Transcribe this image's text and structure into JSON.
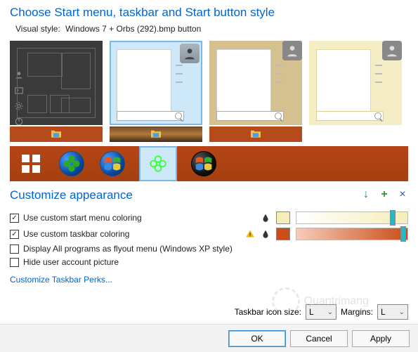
{
  "heading": "Choose Start menu, taskbar and Start button style",
  "visual_style_label": "Visual style:",
  "visual_style_value": "Windows 7 + Orbs (292).bmp button",
  "themes": [
    {
      "id": "modern-dark",
      "selected": false
    },
    {
      "id": "win7-gradient",
      "selected": true
    },
    {
      "id": "win7-tan",
      "selected": false
    },
    {
      "id": "win7-cream",
      "selected": false
    }
  ],
  "orbs": [
    {
      "id": "win8-tiles",
      "selected": false
    },
    {
      "id": "green-clover-sphere",
      "selected": false
    },
    {
      "id": "win7-orb",
      "selected": false
    },
    {
      "id": "glowing-clover",
      "selected": true
    },
    {
      "id": "dark-orb",
      "selected": false
    }
  ],
  "appearance_heading": "Customize appearance",
  "header_icons": {
    "download": "↓",
    "add": "+",
    "close": "×"
  },
  "options": {
    "custom_start_coloring": {
      "label": "Use custom start menu coloring",
      "checked": true
    },
    "custom_taskbar_coloring": {
      "label": "Use custom taskbar coloring",
      "checked": true
    },
    "flyout_menu": {
      "label": "Display All programs as flyout menu (Windows XP style)",
      "checked": false
    },
    "hide_user_pic": {
      "label": "Hide user account picture",
      "checked": false
    }
  },
  "start_color": {
    "swatch": "#f6edb8",
    "slider_pos": 0.88,
    "gradient_from": "#ffffff",
    "gradient_to": "#f6edb8"
  },
  "taskbar_color": {
    "swatch": "#c94e1a",
    "slider_pos": 0.98,
    "gradient_from": "#f7cdb8",
    "gradient_to": "#c94e1a"
  },
  "link_text": "Customize Taskbar Perks...",
  "taskbar_size_label": "Taskbar icon size:",
  "taskbar_size_value": "L",
  "margins_label": "Margins:",
  "margins_value": "L",
  "buttons": {
    "ok": "OK",
    "cancel": "Cancel",
    "apply": "Apply"
  },
  "watermark": "Quantrimang"
}
